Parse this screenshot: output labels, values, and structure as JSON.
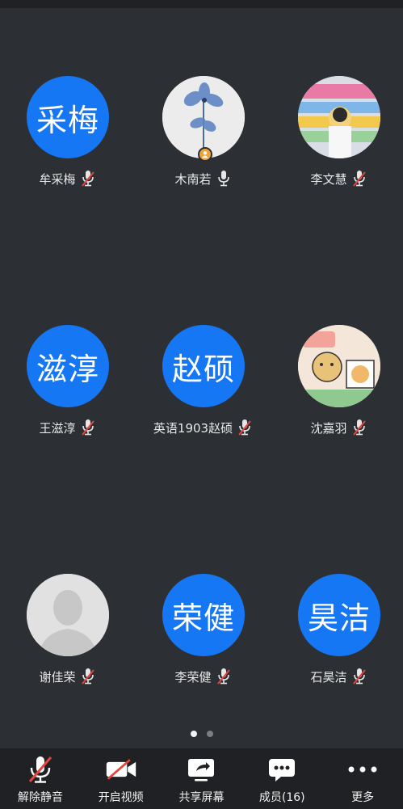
{
  "participants": [
    {
      "avatar_text": "采梅",
      "name": "牟采梅",
      "mic": "muted"
    },
    {
      "avatar_text": "",
      "name": "木南若",
      "mic": "on",
      "host": true
    },
    {
      "avatar_text": "",
      "name": "李文慧",
      "mic": "muted"
    },
    {
      "avatar_text": "滋淳",
      "name": "王滋淳",
      "mic": "muted"
    },
    {
      "avatar_text": "赵硕",
      "name": "英语1903赵硕",
      "mic": "muted"
    },
    {
      "avatar_text": "",
      "name": "沈嘉羽",
      "mic": "muted"
    },
    {
      "avatar_text": "",
      "name": "谢佳荣",
      "mic": "muted"
    },
    {
      "avatar_text": "荣健",
      "name": "李荣健",
      "mic": "muted"
    },
    {
      "avatar_text": "昊洁",
      "name": "石昊洁",
      "mic": "muted"
    }
  ],
  "pager": {
    "pages": 2,
    "current": 1
  },
  "toolbar": {
    "unmute": "解除静音",
    "video": "开启视频",
    "share": "共享屏幕",
    "members": "成员(16)",
    "more": "更多"
  },
  "colors": {
    "background": "#2c2f33",
    "toolbar": "#1f2124",
    "avatar_blue": "#1677f5",
    "muted_red": "#e5443f",
    "host_badge": "#f0a33a"
  }
}
